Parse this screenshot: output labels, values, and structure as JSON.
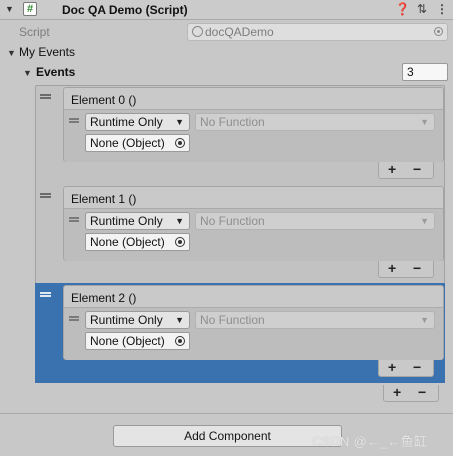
{
  "component": {
    "title": "Doc QA Demo (Script)",
    "enabled": true,
    "icons": [
      "foldout-triangle-icon",
      "script-icon",
      "help-icon",
      "presets-icon",
      "more-icon"
    ]
  },
  "script_row": {
    "label": "Script",
    "value": "docQADemo"
  },
  "my_events": {
    "label": "My Events"
  },
  "events": {
    "label": "Events",
    "size": "3"
  },
  "elements": [
    {
      "title": "Element 0 ()",
      "mode": "Runtime Only",
      "function": "No Function",
      "target": "None (Object)",
      "selected": false
    },
    {
      "title": "Element 1 ()",
      "mode": "Runtime Only",
      "function": "No Function",
      "target": "None (Object)",
      "selected": false
    },
    {
      "title": "Element 2 ()",
      "mode": "Runtime Only",
      "function": "No Function",
      "target": "None (Object)",
      "selected": true
    }
  ],
  "buttons": {
    "plus": "+",
    "minus": "−",
    "add_component": "Add Component"
  },
  "watermark": "CSDN @←_←鱼缸",
  "colors": {
    "selection": "#3a72b0",
    "panel": "#c8c8c8"
  }
}
